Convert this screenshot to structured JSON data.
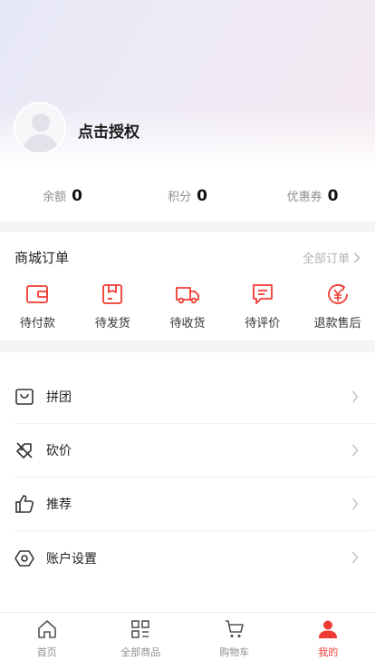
{
  "profile": {
    "name": "点击授权"
  },
  "stats": [
    {
      "label": "余额",
      "value": "0"
    },
    {
      "label": "积分",
      "value": "0"
    },
    {
      "label": "优惠券",
      "value": "0"
    }
  ],
  "orders": {
    "title": "商城订单",
    "all_label": "全部订单",
    "items": [
      {
        "label": "待付款",
        "icon": "wallet-icon"
      },
      {
        "label": "待发货",
        "icon": "box-icon"
      },
      {
        "label": "待收货",
        "icon": "truck-icon"
      },
      {
        "label": "待评价",
        "icon": "comment-icon"
      },
      {
        "label": "退款售后",
        "icon": "refund-icon"
      }
    ]
  },
  "menu": [
    {
      "label": "拼团",
      "icon": "shopping-bag-icon"
    },
    {
      "label": "砍价",
      "icon": "discount-tag-icon"
    },
    {
      "label": "推荐",
      "icon": "thumbs-up-icon"
    },
    {
      "label": "账户设置",
      "icon": "hexagon-settings-icon"
    }
  ],
  "tabbar": [
    {
      "label": "首页",
      "icon": "home-icon"
    },
    {
      "label": "全部商品",
      "icon": "grid-icon"
    },
    {
      "label": "购物车",
      "icon": "cart-icon"
    },
    {
      "label": "我的",
      "icon": "user-icon",
      "active": true
    }
  ],
  "colors": {
    "accent": "#f03b32",
    "muted": "#8f8f8f"
  }
}
